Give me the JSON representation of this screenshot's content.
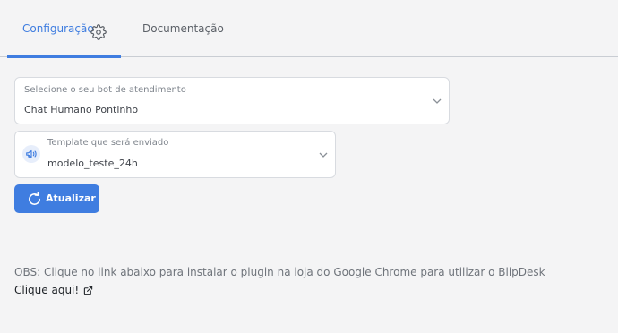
{
  "tabs": {
    "configuracao": "Configuração",
    "documentacao": "Documentação"
  },
  "icons": {
    "tab_gear": "gear-icon",
    "bot_select_chevron": "chevron-down-icon",
    "template_icon": "megaphone-icon",
    "template_select_chevron": "chevron-down-icon",
    "update_button": "refresh-icon",
    "link": "external-link-icon"
  },
  "bot_select": {
    "label": "Selecione o seu bot de atendimento",
    "value": "Chat Humano Pontinho"
  },
  "template_select": {
    "label": "Template que será enviado",
    "value": "modelo_teste_24h"
  },
  "actions": {
    "update_label": "Atualizar"
  },
  "note": {
    "obs_text": "OBS: Clique no link abaixo para instalar o plugin na loja do Google Chrome para utilizar o BlipDesk",
    "link_text": "Clique aqui!"
  },
  "colors": {
    "accent": "#3f7de0",
    "background": "#f4f4f5",
    "card": "#ffffff"
  }
}
